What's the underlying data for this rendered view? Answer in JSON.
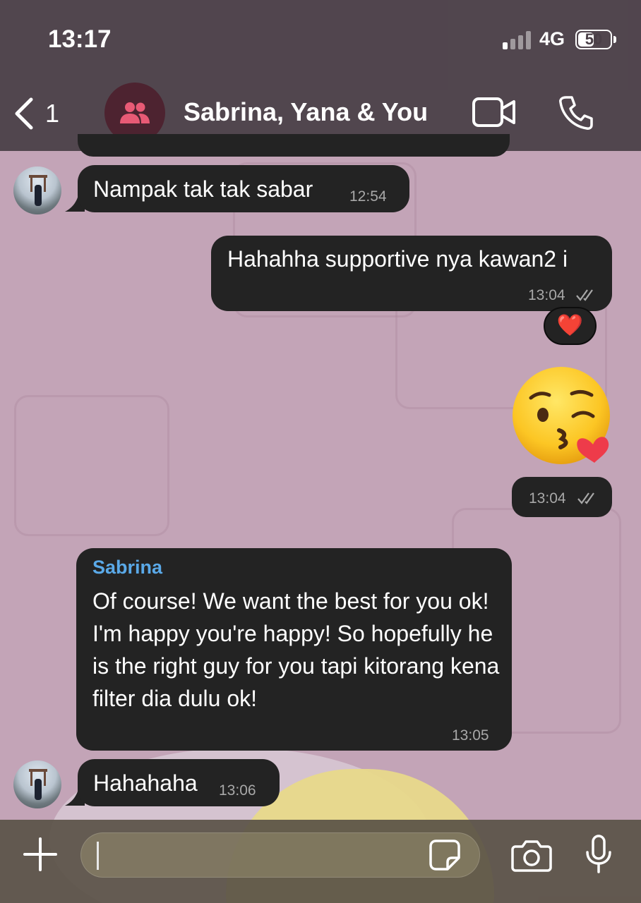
{
  "status_bar": {
    "time": "13:17",
    "network": "4G",
    "battery": "50",
    "battery_level": 0.5
  },
  "header": {
    "back_count": "1",
    "title": "Sabrina, Yana & You",
    "avatar_icon": "group-icon",
    "colors": {
      "avatar_bg": "#4d2330",
      "avatar_icon": "#e85a75"
    }
  },
  "messages": [
    {
      "id": "m1",
      "direction": "incoming",
      "sender": "",
      "text": "Nampak tak tak sabar",
      "time": "12:54"
    },
    {
      "id": "m2",
      "direction": "outgoing",
      "text": "Hahahha supportive nya kawan2 i",
      "time": "13:04",
      "status": "read-double-check-icon",
      "reaction": "❤️"
    },
    {
      "id": "m3",
      "direction": "outgoing",
      "type": "emoji",
      "text": "😘",
      "time": "13:04",
      "status": "read-double-check-icon"
    },
    {
      "id": "m4",
      "direction": "incoming",
      "sender": "Sabrina",
      "text": "Of course! We want the best for you ok! I'm happy you're happy! So hopefully he is the right guy for you tapi kitorang kena filter dia dulu ok!",
      "time": "13:05"
    },
    {
      "id": "m5",
      "direction": "incoming",
      "sender": "",
      "text": "Hahahaha",
      "time": "13:06"
    }
  ],
  "composer": {
    "value": "",
    "placeholder": ""
  },
  "colors": {
    "bubble": "#232323",
    "sender_name": "#5aa9e8",
    "wallpaper": "#c3a4b7"
  }
}
